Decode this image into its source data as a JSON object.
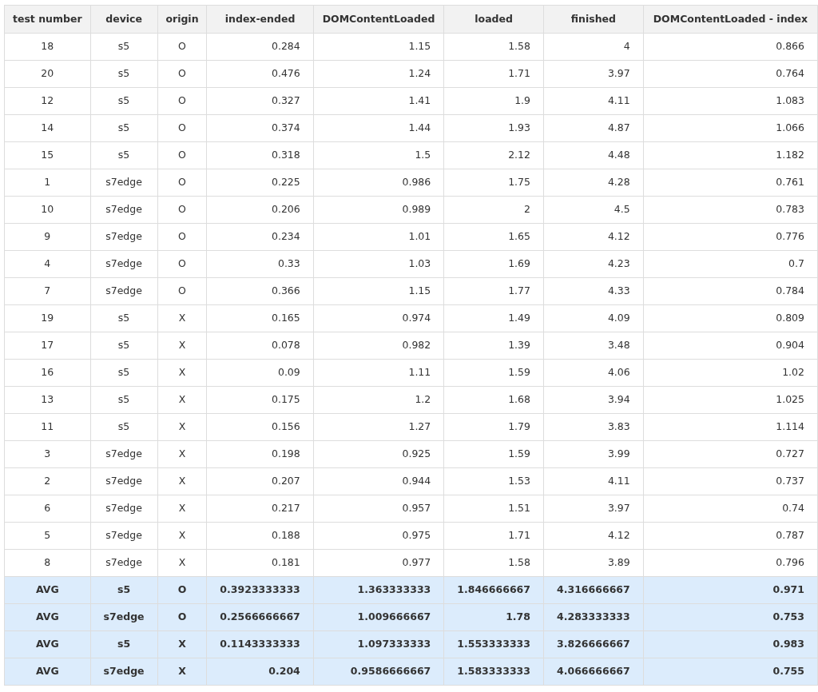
{
  "table": {
    "columns": [
      "test number",
      "device",
      "origin",
      "index-ended",
      "DOMContentLoaded",
      "loaded",
      "finished",
      "DOMContentLoaded - index"
    ],
    "rows": [
      {
        "kind": "data",
        "cells": [
          "18",
          "s5",
          "O",
          "0.284",
          "1.15",
          "1.58",
          "4",
          "0.866"
        ]
      },
      {
        "kind": "data",
        "cells": [
          "20",
          "s5",
          "O",
          "0.476",
          "1.24",
          "1.71",
          "3.97",
          "0.764"
        ]
      },
      {
        "kind": "data",
        "cells": [
          "12",
          "s5",
          "O",
          "0.327",
          "1.41",
          "1.9",
          "4.11",
          "1.083"
        ]
      },
      {
        "kind": "data",
        "cells": [
          "14",
          "s5",
          "O",
          "0.374",
          "1.44",
          "1.93",
          "4.87",
          "1.066"
        ]
      },
      {
        "kind": "data",
        "cells": [
          "15",
          "s5",
          "O",
          "0.318",
          "1.5",
          "2.12",
          "4.48",
          "1.182"
        ]
      },
      {
        "kind": "data",
        "cells": [
          "1",
          "s7edge",
          "O",
          "0.225",
          "0.986",
          "1.75",
          "4.28",
          "0.761"
        ]
      },
      {
        "kind": "data",
        "cells": [
          "10",
          "s7edge",
          "O",
          "0.206",
          "0.989",
          "2",
          "4.5",
          "0.783"
        ]
      },
      {
        "kind": "data",
        "cells": [
          "9",
          "s7edge",
          "O",
          "0.234",
          "1.01",
          "1.65",
          "4.12",
          "0.776"
        ]
      },
      {
        "kind": "data",
        "cells": [
          "4",
          "s7edge",
          "O",
          "0.33",
          "1.03",
          "1.69",
          "4.23",
          "0.7"
        ]
      },
      {
        "kind": "data",
        "cells": [
          "7",
          "s7edge",
          "O",
          "0.366",
          "1.15",
          "1.77",
          "4.33",
          "0.784"
        ]
      },
      {
        "kind": "data",
        "cells": [
          "19",
          "s5",
          "X",
          "0.165",
          "0.974",
          "1.49",
          "4.09",
          "0.809"
        ]
      },
      {
        "kind": "data",
        "cells": [
          "17",
          "s5",
          "X",
          "0.078",
          "0.982",
          "1.39",
          "3.48",
          "0.904"
        ]
      },
      {
        "kind": "data",
        "cells": [
          "16",
          "s5",
          "X",
          "0.09",
          "1.11",
          "1.59",
          "4.06",
          "1.02"
        ]
      },
      {
        "kind": "data",
        "cells": [
          "13",
          "s5",
          "X",
          "0.175",
          "1.2",
          "1.68",
          "3.94",
          "1.025"
        ]
      },
      {
        "kind": "data",
        "cells": [
          "11",
          "s5",
          "X",
          "0.156",
          "1.27",
          "1.79",
          "3.83",
          "1.114"
        ]
      },
      {
        "kind": "data",
        "cells": [
          "3",
          "s7edge",
          "X",
          "0.198",
          "0.925",
          "1.59",
          "3.99",
          "0.727"
        ]
      },
      {
        "kind": "data",
        "cells": [
          "2",
          "s7edge",
          "X",
          "0.207",
          "0.944",
          "1.53",
          "4.11",
          "0.737"
        ]
      },
      {
        "kind": "data",
        "cells": [
          "6",
          "s7edge",
          "X",
          "0.217",
          "0.957",
          "1.51",
          "3.97",
          "0.74"
        ]
      },
      {
        "kind": "data",
        "cells": [
          "5",
          "s7edge",
          "X",
          "0.188",
          "0.975",
          "1.71",
          "4.12",
          "0.787"
        ]
      },
      {
        "kind": "data",
        "cells": [
          "8",
          "s7edge",
          "X",
          "0.181",
          "0.977",
          "1.58",
          "3.89",
          "0.796"
        ]
      },
      {
        "kind": "summary",
        "cells": [
          "AVG",
          "s5",
          "O",
          "0.3923333333",
          "1.363333333",
          "1.846666667",
          "4.316666667",
          "0.971"
        ]
      },
      {
        "kind": "summary",
        "cells": [
          "AVG",
          "s7edge",
          "O",
          "0.2566666667",
          "1.009666667",
          "1.78",
          "4.283333333",
          "0.753"
        ]
      },
      {
        "kind": "summary",
        "cells": [
          "AVG",
          "s5",
          "X",
          "0.1143333333",
          "1.097333333",
          "1.553333333",
          "3.826666667",
          "0.983"
        ]
      },
      {
        "kind": "summary",
        "cells": [
          "AVG",
          "s7edge",
          "X",
          "0.204",
          "0.9586666667",
          "1.583333333",
          "4.066666667",
          "0.755"
        ]
      }
    ]
  }
}
